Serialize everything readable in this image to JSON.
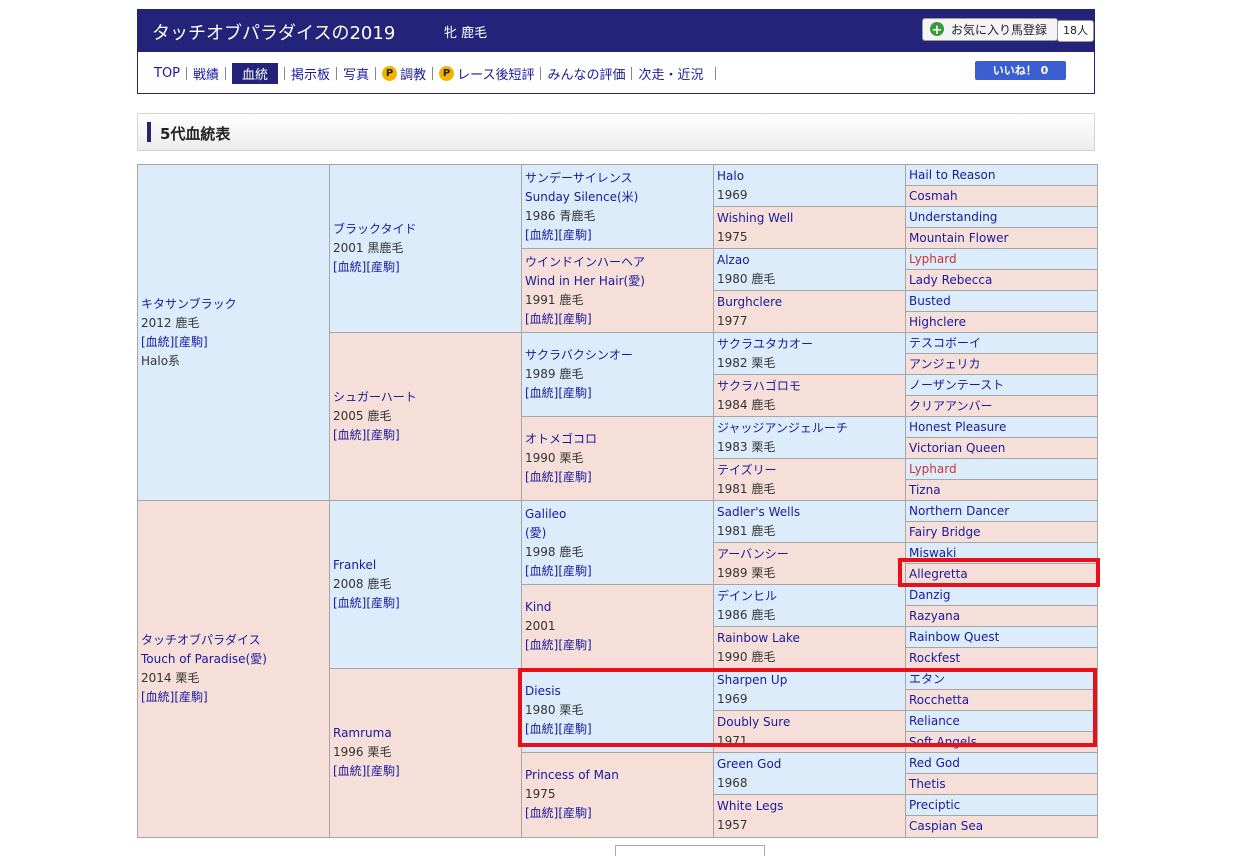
{
  "header": {
    "title": "タッチオブパラダイスの2019",
    "sex_color": "牝 鹿毛",
    "fav_label": "お気に入り馬登録",
    "fav_count": "18人",
    "like_label": "いいね！ 0"
  },
  "nav": [
    {
      "label": "TOP",
      "active": false,
      "badge": false
    },
    {
      "label": "戦績",
      "active": false,
      "badge": false
    },
    {
      "label": "血統",
      "active": true,
      "badge": false
    },
    {
      "label": "掲示板",
      "active": false,
      "badge": false
    },
    {
      "label": "写真",
      "active": false,
      "badge": false
    },
    {
      "label": "調教",
      "active": false,
      "badge": true
    },
    {
      "label": "レース後短評",
      "active": false,
      "badge": true
    },
    {
      "label": "みんなの評価",
      "active": false,
      "badge": false
    },
    {
      "label": "次走・近況",
      "active": false,
      "badge": false
    }
  ],
  "badge_label": "P",
  "section_title": "5代血統表",
  "links": "[血統][産駒]",
  "g1": [
    {
      "name": "キタサンブラック",
      "year": "2012 鹿毛",
      "extra": "Halo系"
    },
    {
      "name": "タッチオブパラダイス",
      "sub": "Touch of Paradise(愛)",
      "year": "2014 栗毛"
    }
  ],
  "g2": [
    {
      "name": "ブラックタイド",
      "year": "2001 黒鹿毛"
    },
    {
      "name": "シュガーハート",
      "year": "2005 鹿毛"
    },
    {
      "name": "Frankel",
      "year": "2008 鹿毛"
    },
    {
      "name": "Ramruma",
      "year": "1996 栗毛"
    }
  ],
  "g3": [
    {
      "name": "サンデーサイレンス",
      "sub": "Sunday Silence(米)",
      "year": "1986 青鹿毛"
    },
    {
      "name": "ウインドインハーヘア",
      "sub": "Wind in Her Hair(愛)",
      "year": "1991 鹿毛"
    },
    {
      "name": "サクラバクシンオー",
      "year": "1989 鹿毛"
    },
    {
      "name": "オトメゴコロ",
      "year": "1990 栗毛"
    },
    {
      "name": "Galileo",
      "sub": "(愛)",
      "year": "1998 鹿毛"
    },
    {
      "name": "Kind",
      "year": "2001"
    },
    {
      "name": "Diesis",
      "year": "1980 栗毛"
    },
    {
      "name": "Princess of Man",
      "year": "1975"
    }
  ],
  "g4": [
    {
      "name": "Halo",
      "year": "1969"
    },
    {
      "name": "Wishing Well",
      "year": "1975"
    },
    {
      "name": "Alzao",
      "year": "1980 鹿毛"
    },
    {
      "name": "Burghclere",
      "year": "1977"
    },
    {
      "name": "サクラユタカオー",
      "year": "1982 栗毛"
    },
    {
      "name": "サクラハゴロモ",
      "year": "1984 鹿毛"
    },
    {
      "name": "ジャッジアンジェルーチ",
      "year": "1983 栗毛"
    },
    {
      "name": "テイズリー",
      "year": "1981 鹿毛"
    },
    {
      "name": "Sadler's Wells",
      "year": "1981 鹿毛"
    },
    {
      "name": "アーバンシー",
      "year": "1989 栗毛"
    },
    {
      "name": "デインヒル",
      "year": "1986 鹿毛"
    },
    {
      "name": "Rainbow Lake",
      "year": "1990 鹿毛"
    },
    {
      "name": "Sharpen Up",
      "year": "1969"
    },
    {
      "name": "Doubly Sure",
      "year": "1971"
    },
    {
      "name": "Green God",
      "year": "1968"
    },
    {
      "name": "White Legs",
      "year": "1957"
    }
  ],
  "g5": [
    {
      "name": "Hail to Reason",
      "red": false
    },
    {
      "name": "Cosmah",
      "red": false
    },
    {
      "name": "Understanding",
      "red": false
    },
    {
      "name": "Mountain Flower",
      "red": false
    },
    {
      "name": "Lyphard",
      "red": true
    },
    {
      "name": "Lady Rebecca",
      "red": false
    },
    {
      "name": "Busted",
      "red": false
    },
    {
      "name": "Highclere",
      "red": false
    },
    {
      "name": "テスコボーイ",
      "red": false
    },
    {
      "name": "アンジェリカ",
      "red": false
    },
    {
      "name": "ノーザンテースト",
      "red": false
    },
    {
      "name": "クリアアンバー",
      "red": false
    },
    {
      "name": "Honest Pleasure",
      "red": false
    },
    {
      "name": "Victorian Queen",
      "red": false
    },
    {
      "name": "Lyphard",
      "red": true
    },
    {
      "name": "Tizna",
      "red": false
    },
    {
      "name": "Northern Dancer",
      "red": false
    },
    {
      "name": "Fairy Bridge",
      "red": false
    },
    {
      "name": "Miswaki",
      "red": false
    },
    {
      "name": "Allegretta",
      "red": false
    },
    {
      "name": "Danzig",
      "red": false
    },
    {
      "name": "Razyana",
      "red": false
    },
    {
      "name": "Rainbow Quest",
      "red": false
    },
    {
      "name": "Rockfest",
      "red": false
    },
    {
      "name": "エタン",
      "red": false
    },
    {
      "name": "Rocchetta",
      "red": false
    },
    {
      "name": "Reliance",
      "red": false
    },
    {
      "name": "Soft Angels",
      "red": false
    },
    {
      "name": "Red God",
      "red": false
    },
    {
      "name": "Thetis",
      "red": false
    },
    {
      "name": "Preciptic",
      "red": false
    },
    {
      "name": "Caspian Sea",
      "red": false
    }
  ]
}
